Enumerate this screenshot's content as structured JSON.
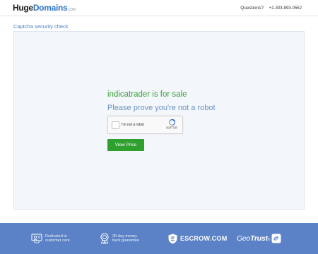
{
  "header": {
    "logo": {
      "huge": "Huge",
      "domains": "Domains",
      "com": ".com"
    },
    "questions_label": "Questions?",
    "phone": "+1-303-893-0552"
  },
  "breadcrumb": "Captcha security check",
  "main": {
    "sale_text": "indicatrader is for sale",
    "prove_text": "Please prove you're not a robot",
    "captcha": {
      "checkbox_label": "I'm not a robot",
      "brand": "reCAPTCHA",
      "privacy_terms": "Privacy - Terms"
    },
    "view_price_button": "View Price"
  },
  "footer": {
    "customer_care": {
      "icon": "support-icon",
      "line1": "Dedicated to",
      "line2": "customer care"
    },
    "guarantee": {
      "icon": "badge-icon",
      "line1": "30-day money",
      "line2": "back guarantee"
    },
    "escrow": {
      "icon": "shield-icon",
      "label": "ESCROW.COM"
    },
    "geotrust": {
      "label_light": "Geo",
      "label_bold": "Trust",
      "reg": "®"
    }
  },
  "colors": {
    "brand_blue": "#2f75c4",
    "sale_green": "#3aa33a",
    "button_green": "#2ea02e",
    "footer_blue": "#5b82c6"
  }
}
